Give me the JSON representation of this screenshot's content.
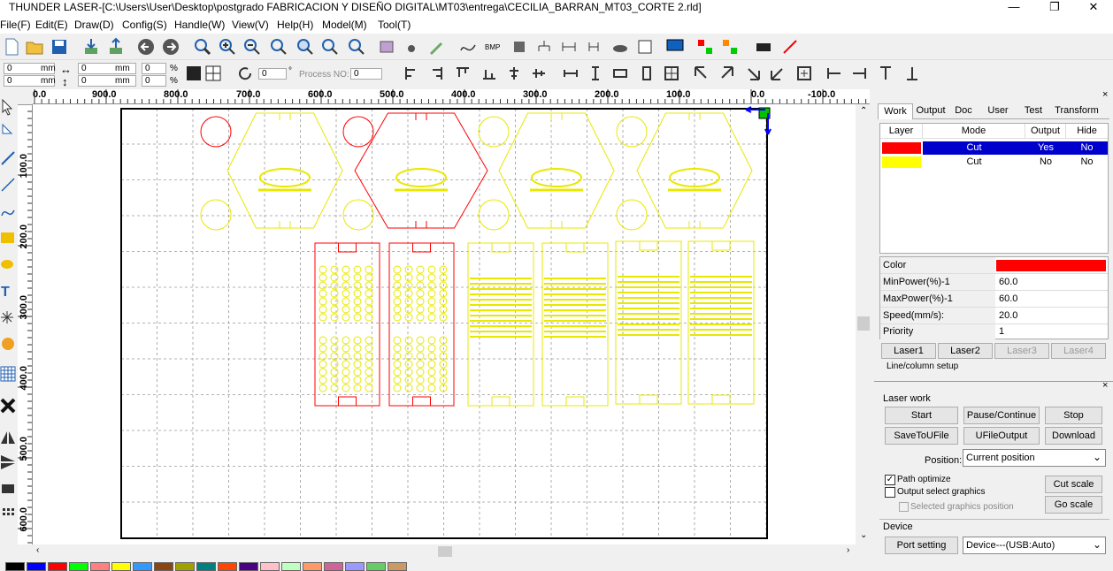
{
  "window": {
    "title": "THUNDER LASER-[C:\\Users\\User\\Desktop\\postgrado FABRICACION Y DISEÑO DIGITAL\\MT03\\entrega\\CECILIA_BARRAN_MT03_CORTE 2.rld]",
    "min": "—",
    "max": "❐",
    "close": "✕"
  },
  "menu": [
    "File(F)",
    "Edit(E)",
    "Draw(D)",
    "Config(S)",
    "Handle(W)",
    "View(V)",
    "Help(H)",
    "Model(M)",
    "Tool(T)"
  ],
  "toolbar2": {
    "x_value": "0",
    "y_value": "0",
    "w_value": "0",
    "h_value": "0",
    "unit": "mm",
    "pct": "%",
    "pct_w": "0",
    "pct_h": "0",
    "angle": "0",
    "deg": "°",
    "process_label": "Process NO:",
    "process_value": "0"
  },
  "ruler": {
    "h_labels": [
      "0.0",
      "900.0",
      "800.0",
      "700.0",
      "600.0",
      "500.0",
      "400.0",
      "300.0",
      "200.0",
      "100.0",
      "0.0",
      "-100.0"
    ],
    "v_labels": [
      "100.0",
      "200.0",
      "300.0",
      "400.0",
      "500.0",
      "600.0"
    ]
  },
  "colors": {
    "layer_red": "#ff0000",
    "layer_yellow": "#ffff00",
    "select_blue": "#0000cc"
  },
  "panel": {
    "tabs": [
      "Work",
      "Output",
      "Doc",
      "User",
      "Test",
      "Transform"
    ],
    "layer_headers": [
      "Layer",
      "Mode",
      "Output",
      "Hide"
    ],
    "layers": [
      {
        "mode": "Cut",
        "output": "Yes",
        "hide": "No"
      },
      {
        "mode": "Cut",
        "output": "No",
        "hide": "No"
      }
    ],
    "props": [
      {
        "name": "Color",
        "value": ""
      },
      {
        "name": "MinPower(%)-1",
        "value": "60.0"
      },
      {
        "name": "MaxPower(%)-1",
        "value": "60.0"
      },
      {
        "name": "Speed(mm/s):",
        "value": "20.0"
      },
      {
        "name": "Priority",
        "value": "1"
      }
    ],
    "laser_buttons": [
      "Laser1",
      "Laser2",
      "Laser3",
      "Laser4"
    ],
    "line_col": "Line/column setup",
    "laser_work": "Laser work",
    "buttons": {
      "start": "Start",
      "pause": "Pause/Continue",
      "stop": "Stop",
      "save": "SaveToUFile",
      "ufile": "UFileOutput",
      "download": "Download",
      "cut_scale": "Cut scale",
      "go_scale": "Go scale",
      "port": "Port setting"
    },
    "position_label": "Position:",
    "position_value": "Current position",
    "path_optimize": "Path optimize",
    "output_select": "Output select graphics",
    "selected_pos": "Selected graphics position",
    "device_label": "Device",
    "device_value": "Device---(USB:Auto)"
  },
  "palette": [
    "#000000",
    "#0000ff",
    "#ff0000",
    "#00ff00",
    "#ff8080",
    "#ffff00",
    "#3399ff",
    "#8b4513",
    "#a0a000",
    "#008080",
    "#ff4500",
    "#4b0082",
    "#ffc0cb",
    "#c0ffc0",
    "#ff9966",
    "#cc6699",
    "#9999ff",
    "#66cc66",
    "#cc9966"
  ]
}
